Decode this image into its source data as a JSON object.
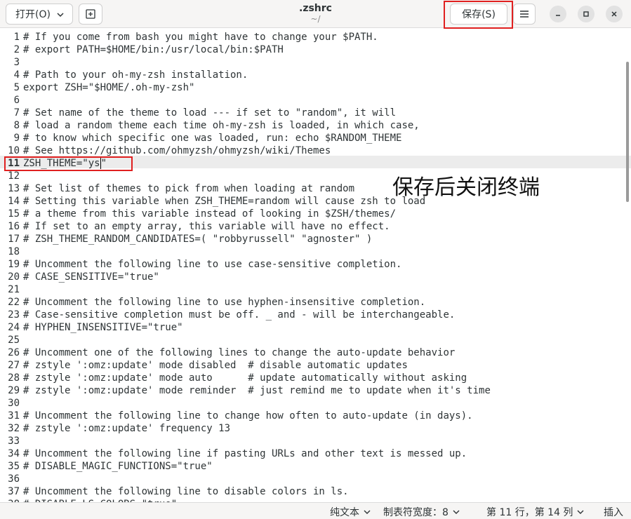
{
  "header": {
    "open_label": "打开(O)",
    "title": ".zshrc",
    "subtitle": "~/",
    "save_label": "保存(S)"
  },
  "editor": {
    "current_line": 11,
    "lines": [
      "# If you come from bash you might have to change your $PATH.",
      "# export PATH=$HOME/bin:/usr/local/bin:$PATH",
      "",
      "# Path to your oh-my-zsh installation.",
      "export ZSH=\"$HOME/.oh-my-zsh\"",
      "",
      "# Set name of the theme to load --- if set to \"random\", it will",
      "# load a random theme each time oh-my-zsh is loaded, in which case,",
      "# to know which specific one was loaded, run: echo $RANDOM_THEME",
      "# See https://github.com/ohmyzsh/ohmyzsh/wiki/Themes",
      "ZSH_THEME=\"ys\"",
      "",
      "# Set list of themes to pick from when loading at random",
      "# Setting this variable when ZSH_THEME=random will cause zsh to load",
      "# a theme from this variable instead of looking in $ZSH/themes/",
      "# If set to an empty array, this variable will have no effect.",
      "# ZSH_THEME_RANDOM_CANDIDATES=( \"robbyrussell\" \"agnoster\" )",
      "",
      "# Uncomment the following line to use case-sensitive completion.",
      "# CASE_SENSITIVE=\"true\"",
      "",
      "# Uncomment the following line to use hyphen-insensitive completion.",
      "# Case-sensitive completion must be off. _ and - will be interchangeable.",
      "# HYPHEN_INSENSITIVE=\"true\"",
      "",
      "# Uncomment one of the following lines to change the auto-update behavior",
      "# zstyle ':omz:update' mode disabled  # disable automatic updates",
      "# zstyle ':omz:update' mode auto      # update automatically without asking",
      "# zstyle ':omz:update' mode reminder  # just remind me to update when it's time",
      "",
      "# Uncomment the following line to change how often to auto-update (in days).",
      "# zstyle ':omz:update' frequency 13",
      "",
      "# Uncomment the following line if pasting URLs and other text is messed up.",
      "# DISABLE_MAGIC_FUNCTIONS=\"true\"",
      "",
      "# Uncomment the following line to disable colors in ls.",
      "# DISABLE_LS_COLORS=\"true\""
    ]
  },
  "annotation": {
    "text": "保存后关闭终端",
    "box_color": "#e02020"
  },
  "statusbar": {
    "syntax": "纯文本",
    "tab_width": "制表符宽度：8",
    "position": "第 11 行，第 14 列",
    "mode": "插入"
  },
  "icons": {
    "open_chevron": "chevron-down-icon",
    "new_tab": "new-tab-icon",
    "menu": "hamburger-menu-icon",
    "minimize": "minimize-icon",
    "maximize": "maximize-icon",
    "close": "close-icon"
  }
}
